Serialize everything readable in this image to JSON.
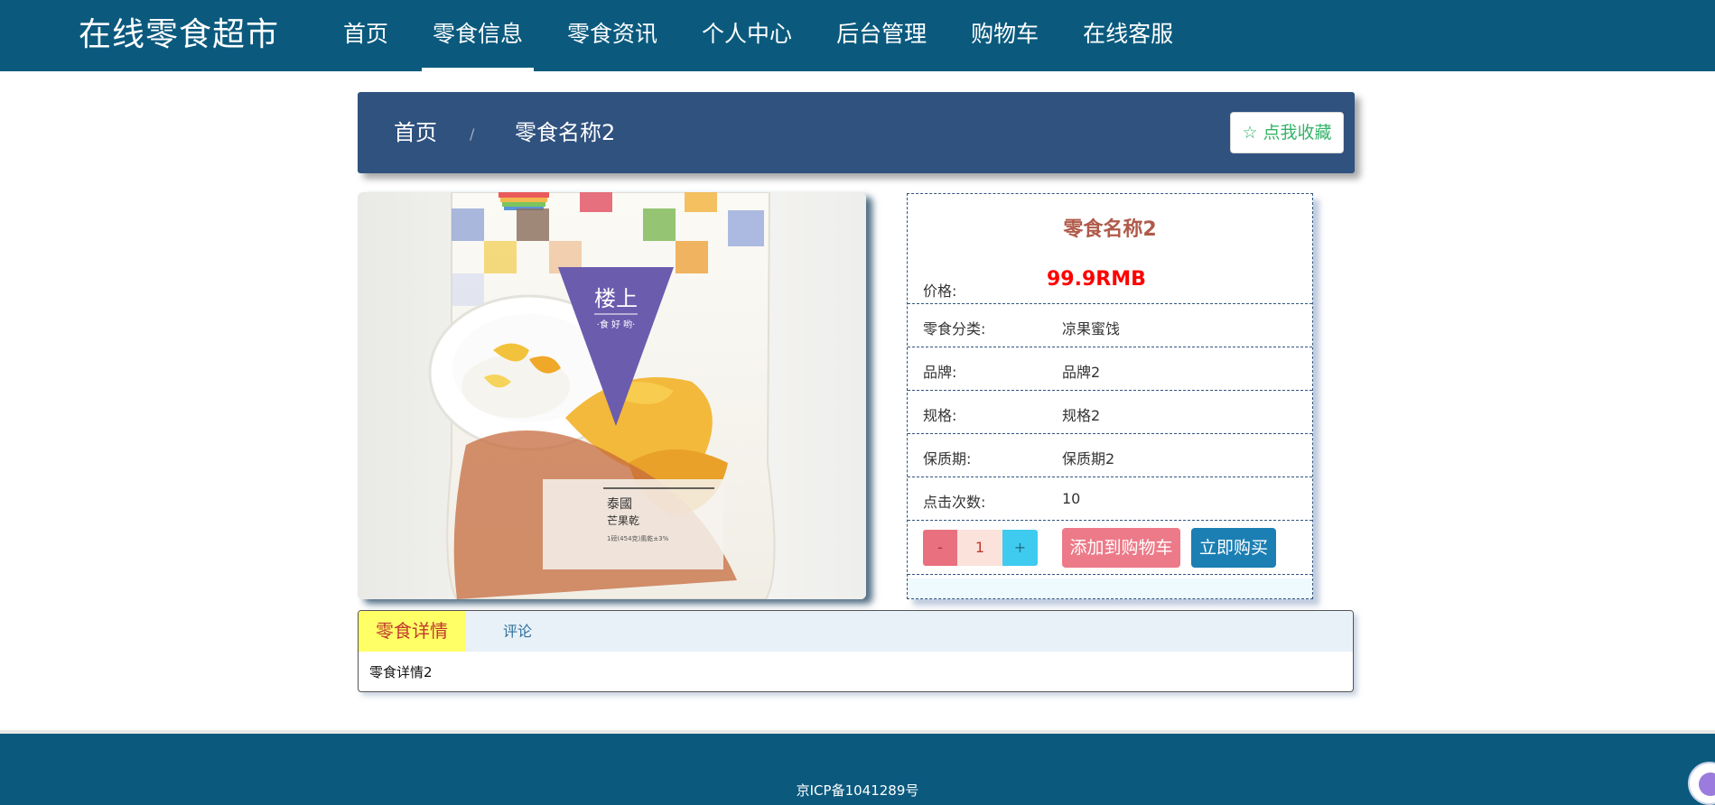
{
  "header": {
    "brand": "在线零食超市",
    "nav": [
      {
        "label": "首页",
        "active": false
      },
      {
        "label": "零食信息",
        "active": true
      },
      {
        "label": "零食资讯",
        "active": false
      },
      {
        "label": "个人中心",
        "active": false
      },
      {
        "label": "后台管理",
        "active": false
      },
      {
        "label": "购物车",
        "active": false
      },
      {
        "label": "在线客服",
        "active": false
      }
    ]
  },
  "breadcrumb": {
    "home": "首页",
    "separator": "/",
    "current": "零食名称2",
    "favorite_label": "☆ 点我收藏"
  },
  "product": {
    "image_text": {
      "brand_mark": "楼上",
      "brand_slogan": "·食 好 哟·",
      "label_line1": "泰國",
      "label_line2": "芒果乾",
      "label_line3": "1磅(454克)風乾±3%"
    },
    "name": "零食名称2",
    "price_label": "价格:",
    "price": "99.9RMB",
    "attributes": [
      {
        "label": "零食分类:",
        "value": "凉果蜜饯"
      },
      {
        "label": "品牌:",
        "value": "品牌2"
      },
      {
        "label": "规格:",
        "value": "规格2"
      },
      {
        "label": "保质期:",
        "value": "保质期2"
      },
      {
        "label": "点击次数:",
        "value": "10"
      }
    ],
    "quantity": {
      "minus": "-",
      "value": "1",
      "plus": "+"
    },
    "add_to_cart": "添加到购物车",
    "buy_now": "立即购买"
  },
  "tabs": {
    "detail_label": "零食详情",
    "comment_label": "评论",
    "detail_content": "零食详情2"
  },
  "footer": {
    "icp": "京ICP备1041289号"
  },
  "colors": {
    "header_bg": "#0b5a7e",
    "breadcrumb_bg": "#30527f",
    "price": "#ff0000",
    "cart_button": "#ec7a89",
    "buy_button": "#1b7fb3"
  }
}
